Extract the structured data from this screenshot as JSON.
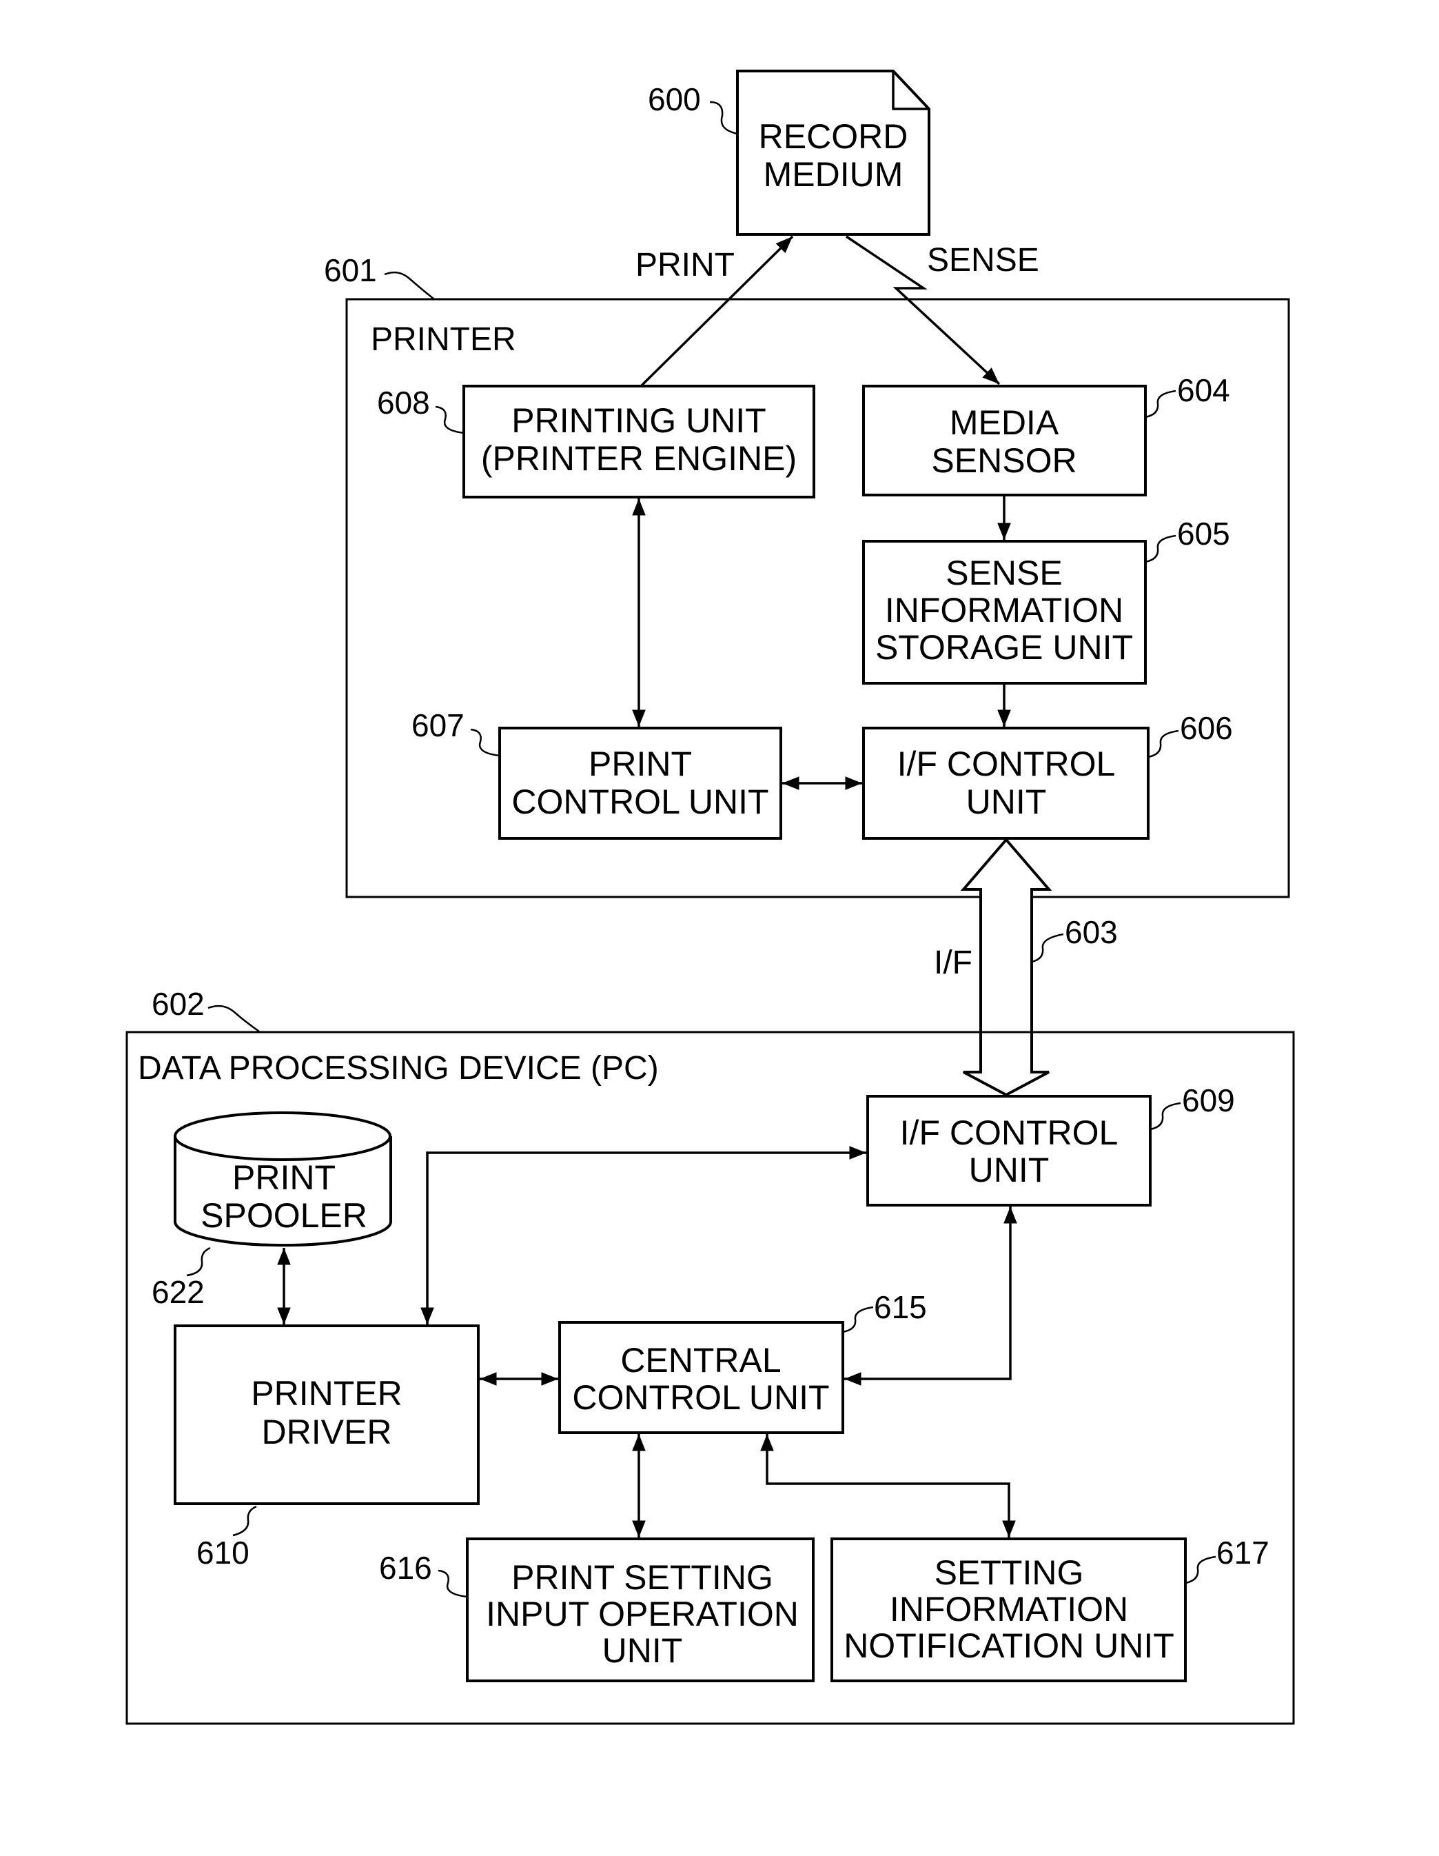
{
  "diagram": {
    "record_medium": {
      "ref": "600",
      "lines": [
        "RECORD",
        "MEDIUM"
      ]
    },
    "arrows": {
      "print_label": "PRINT",
      "sense_label": "SENSE",
      "if_label": "I/F",
      "if_ref": "603"
    },
    "printer": {
      "ref": "601",
      "title": "PRINTER",
      "printing_unit": {
        "ref": "608",
        "lines": [
          "PRINTING UNIT",
          "(PRINTER ENGINE)"
        ]
      },
      "media_sensor": {
        "ref": "604",
        "lines": [
          "MEDIA",
          "SENSOR"
        ]
      },
      "sense_storage": {
        "ref": "605",
        "lines": [
          "SENSE",
          "INFORMATION",
          "STORAGE UNIT"
        ]
      },
      "print_control": {
        "ref": "607",
        "lines": [
          "PRINT",
          "CONTROL UNIT"
        ]
      },
      "if_control": {
        "ref": "606",
        "lines": [
          "I/F CONTROL",
          "UNIT"
        ]
      }
    },
    "pc": {
      "ref": "602",
      "title": "DATA PROCESSING DEVICE (PC)",
      "if_control": {
        "ref": "609",
        "lines": [
          "I/F CONTROL",
          "UNIT"
        ]
      },
      "print_spooler": {
        "ref": "622",
        "lines": [
          "PRINT",
          "SPOOLER"
        ]
      },
      "printer_driver": {
        "ref": "610",
        "lines": [
          "PRINTER",
          "DRIVER"
        ]
      },
      "central_control": {
        "ref": "615",
        "lines": [
          "CENTRAL",
          "CONTROL UNIT"
        ]
      },
      "print_setting": {
        "ref": "616",
        "lines": [
          "PRINT SETTING",
          "INPUT OPERATION",
          "UNIT"
        ]
      },
      "setting_notification": {
        "ref": "617",
        "lines": [
          "SETTING",
          "INFORMATION",
          "NOTIFICATION UNIT"
        ]
      }
    }
  }
}
